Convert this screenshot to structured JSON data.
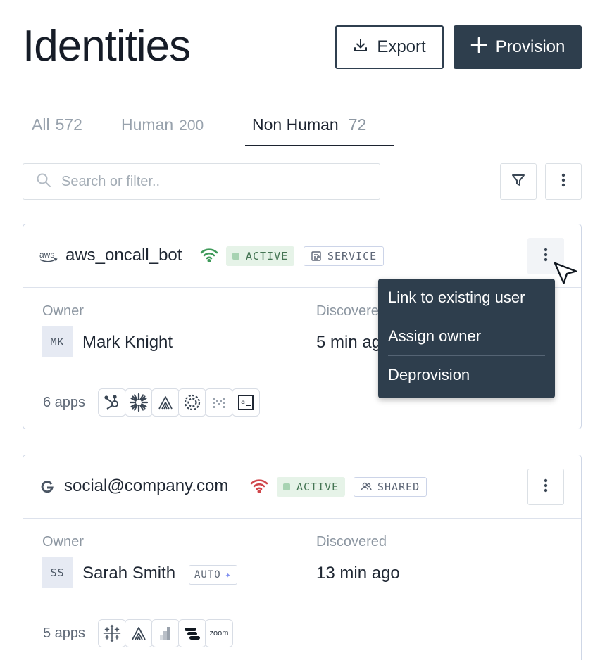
{
  "header": {
    "title": "Identities",
    "export_label": "Export",
    "provision_label": "Provision"
  },
  "tabs": [
    {
      "label": "All",
      "count": "572"
    },
    {
      "label": "Human",
      "count": "200"
    },
    {
      "label": "Non Human",
      "count": "72",
      "active": true
    }
  ],
  "search": {
    "placeholder": "Search or filter..",
    "value": ""
  },
  "cards": [
    {
      "name": "aws_oncall_bot",
      "provider_icon": "aws-logo",
      "signal_color": "#3f9a5a",
      "status": "ACTIVE",
      "type": "SERVICE",
      "owner_label": "Owner",
      "owner_initials": "MK",
      "owner_name": "Mark Knight",
      "discovered_label": "Discovered",
      "discovered_value": "5 min ago",
      "apps_count": "6 apps",
      "apps": [
        "hubspot-icon",
        "sunburst-icon",
        "anthropic-icon",
        "openai-icon",
        "dots-grid-icon",
        "terminal-icon"
      ]
    },
    {
      "name": "social@company.com",
      "provider_icon": "google-logo",
      "signal_color": "#d0464b",
      "status": "ACTIVE",
      "type": "SHARED",
      "owner_label": "Owner",
      "owner_initials": "SS",
      "owner_name": "Sarah Smith",
      "owner_tag": "AUTO",
      "discovered_label": "Discovered",
      "discovered_value": "13 min ago",
      "apps_count": "5 apps",
      "apps": [
        "tableau-icon",
        "anthropic-icon",
        "bars-icon",
        "stack-icon",
        "zoom-icon"
      ],
      "zoom_text": "zoom"
    }
  ],
  "context_menu": {
    "items": [
      "Link to existing user",
      "Assign owner",
      "Deprovision"
    ]
  },
  "colors": {
    "primary": "#2e3e4d",
    "active_badge_bg": "#e6f3e8",
    "active_badge_text": "#447553",
    "card_border": "#cfd7e6"
  }
}
